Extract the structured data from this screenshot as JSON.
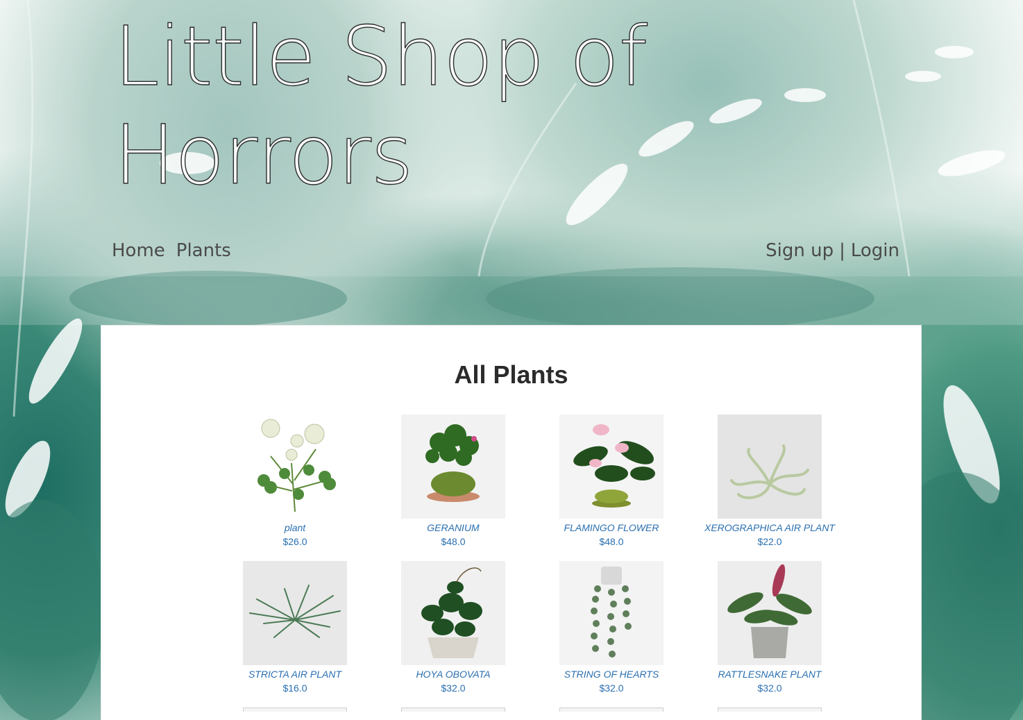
{
  "site": {
    "title": "Little Shop of Horrors"
  },
  "nav": {
    "home": "Home",
    "plants": "Plants",
    "signup": "Sign up",
    "separator": "|",
    "login": "Login"
  },
  "main": {
    "heading": "All Plants",
    "products": [
      {
        "name": "plant",
        "price": "$26.0",
        "icon": "clover-image",
        "style": "clover"
      },
      {
        "name": "GERANIUM",
        "price": "$48.0",
        "icon": "geranium-image",
        "style": "bonsai"
      },
      {
        "name": "FLAMINGO FLOWER",
        "price": "$48.0",
        "icon": "flamingo-flower-image",
        "style": "anthurium"
      },
      {
        "name": "XEROGRAPHICA AIR PLANT",
        "price": "$22.0",
        "icon": "air-plant-image",
        "style": "airplant"
      },
      {
        "name": "STRICTA AIR PLANT",
        "price": "$16.0",
        "icon": "stricta-image",
        "style": "stricta"
      },
      {
        "name": "HOYA OBOVATA",
        "price": "$32.0",
        "icon": "hoya-image",
        "style": "hoya"
      },
      {
        "name": "STRING OF HEARTS",
        "price": "$32.0",
        "icon": "string-of-hearts-image",
        "style": "hanging"
      },
      {
        "name": "RATTLESNAKE PLANT",
        "price": "$32.0",
        "icon": "rattlesnake-plant-image",
        "style": "calathea"
      }
    ]
  },
  "colors": {
    "link": "#2a6fb0",
    "heading": "#2b2b2b",
    "nav": "#4a4a4a"
  }
}
